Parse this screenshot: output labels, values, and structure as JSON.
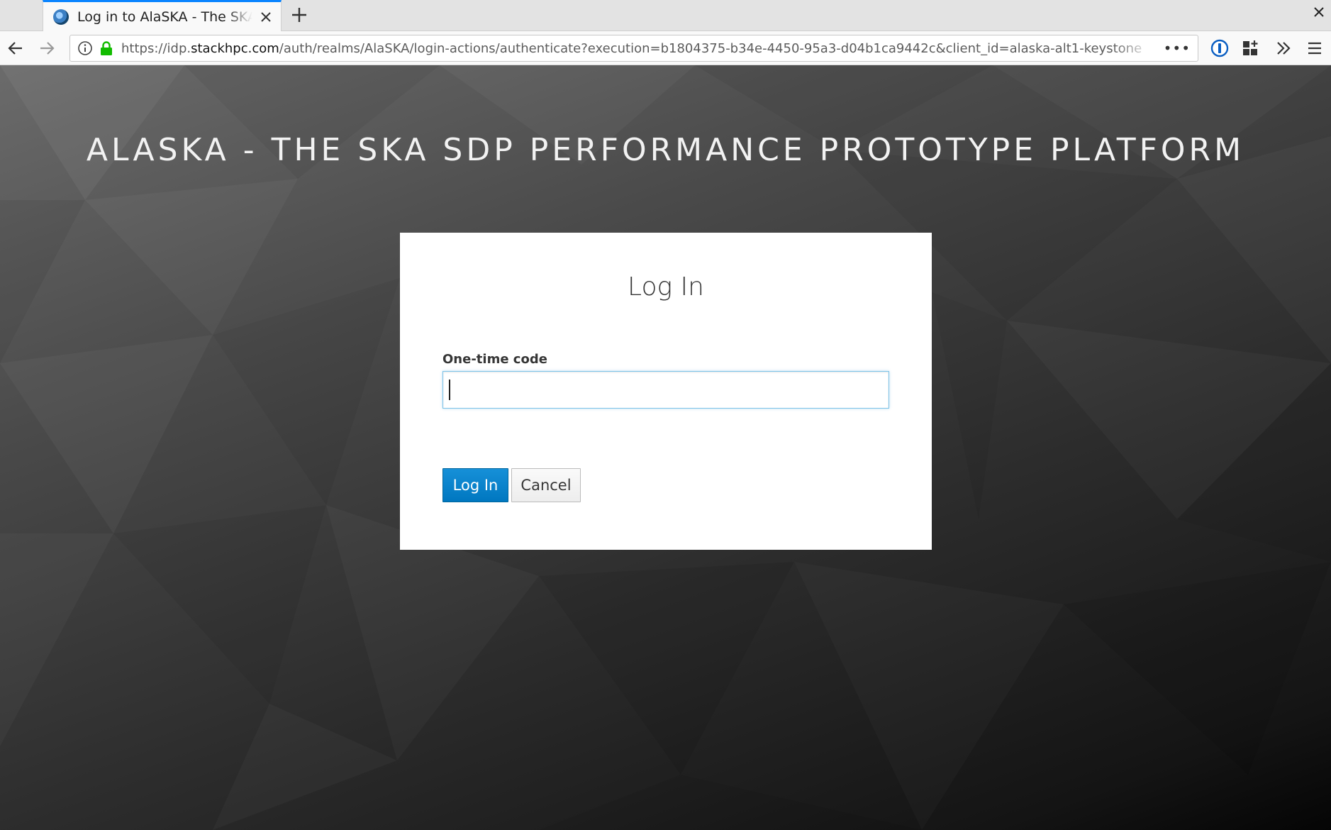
{
  "browser": {
    "tab_title": "Log in to AlaSKA - The SKA SDP Performance Prototype Platform",
    "url_prefix": "https://idp.",
    "url_domain": "stackhpc.com",
    "url_path": "/auth/realms/AlaSKA/login-actions/authenticate?execution=b1804375-b34e-4450-95a3-d04b1ca9442c&client_id=alaska-alt1-keystone",
    "more_label": "•••"
  },
  "page": {
    "banner": "ALASKA - THE SKA SDP PERFORMANCE PROTOTYPE PLATFORM"
  },
  "login": {
    "title": "Log In",
    "otp_label": "One-time code",
    "otp_value": "",
    "submit_label": "Log In",
    "cancel_label": "Cancel"
  },
  "colors": {
    "tab_accent": "#0a84ff",
    "primary_button": "#0088ce",
    "secure_lock": "#12bc00"
  }
}
